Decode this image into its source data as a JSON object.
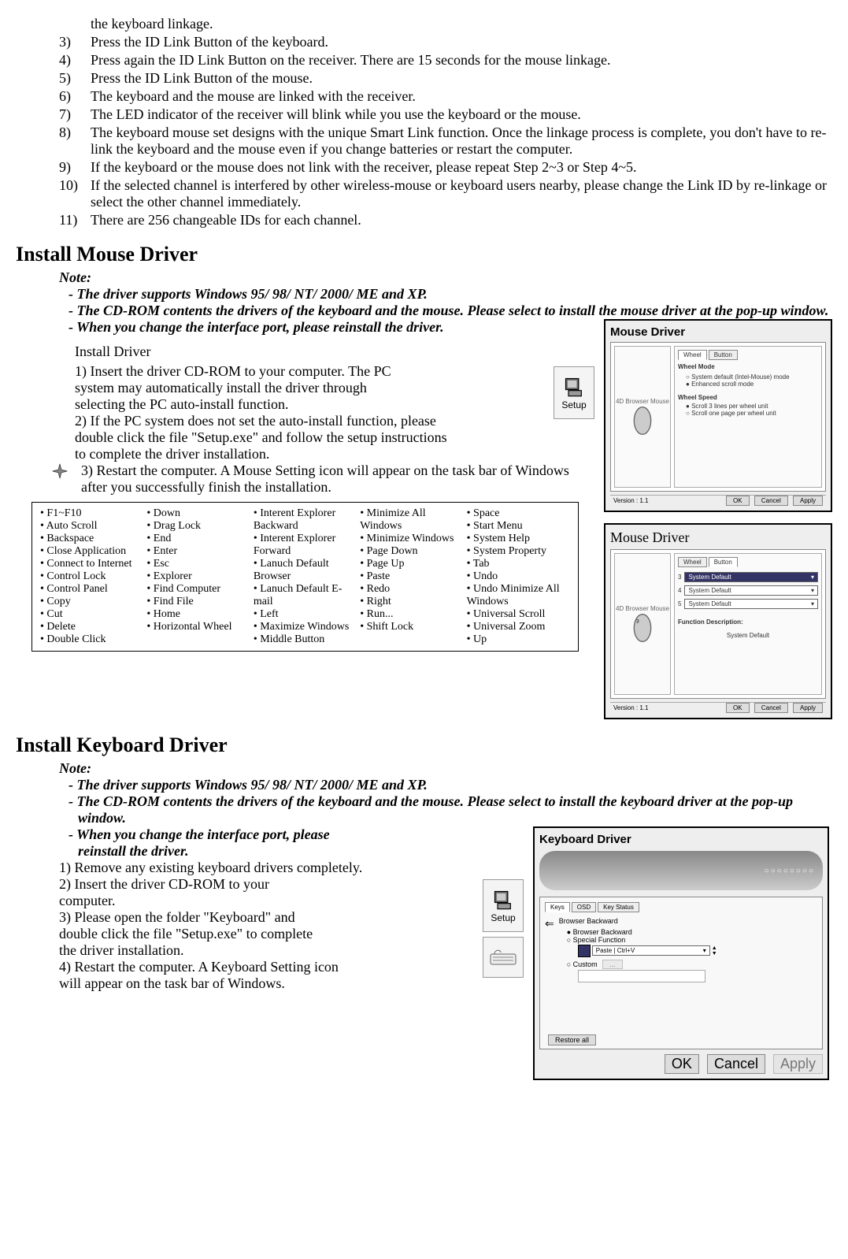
{
  "top_steps": [
    {
      "n": "",
      "t": "the keyboard linkage."
    },
    {
      "n": "3)",
      "t": "Press the ID Link Button of the keyboard."
    },
    {
      "n": "4)",
      "t": "Press again the ID Link Button on the receiver.  There are 15 seconds for the mouse linkage."
    },
    {
      "n": "5)",
      "t": "Press the ID Link Button of the mouse."
    },
    {
      "n": "6)",
      "t": "The keyboard and the mouse are linked with the receiver."
    },
    {
      "n": "7)",
      "t": "The LED indicator of the receiver will blink while you use the keyboard or the mouse."
    },
    {
      "n": "8)",
      "t": "The keyboard mouse set designs with the unique Smart Link function.  Once the linkage process is complete, you don't have to re-link the keyboard and the mouse even if you change batteries or restart the computer."
    },
    {
      "n": "9)",
      "t": "If the keyboard or the mouse does not link with the receiver, please repeat Step 2~3 or Step 4~5."
    },
    {
      "n": "10)",
      "t": "If the selected channel is interfered by other wireless-mouse or keyboard users nearby, please change the Link ID by re-linkage or select the other channel immediately."
    },
    {
      "n": "11)",
      "t": "There are 256 changeable IDs for each channel."
    }
  ],
  "mouse": {
    "heading": "Install Mouse Driver",
    "note_label": "Note:",
    "notes": [
      "- The driver supports Windows 95/ 98/ NT/ 2000/ ME and XP.",
      "- The CD-ROM contents the drivers of the keyboard and the mouse.  Please select to install the mouse driver at the pop-up window.",
      "- When you change the interface port, please reinstall the driver."
    ],
    "install_title": "Install Driver",
    "install_steps": [
      "1) Insert the driver CD-ROM to your computer.  The PC system may automatically install the driver through selecting the PC auto-install function.",
      "2) If the PC system does not set the auto-install function, please double click the file \"Setup.exe\" and follow the setup instructions to complete the driver installation.",
      "3) Restart the computer.  A Mouse Setting icon will appear on the task bar of Windows after you successfully finish the installation."
    ],
    "setup_label": "Setup",
    "shot1": {
      "title": "Mouse Driver",
      "left_label": "4D Browser Mouse",
      "version": "Version : 1.1",
      "tab1": "Wheel",
      "tab2": "Button",
      "heading": "Wheel Mode",
      "opt1": "System default (Intel-Mouse) mode",
      "opt2": "Enhanced scroll mode",
      "heading2": "Wheel Speed",
      "opt3": "Scroll   3   lines per wheel unit",
      "opt4": "Scroll one page per wheel unit",
      "btn_ok": "OK",
      "btn_cancel": "Cancel",
      "btn_apply": "Apply"
    },
    "shot2": {
      "title": "Mouse Driver",
      "left_label": "4D Browser Mouse",
      "version": "Version : 1.1",
      "tab1": "Wheel",
      "tab2": "Button",
      "row3": "3",
      "row4": "4",
      "row5": "5",
      "dd_label": "System Default",
      "dd_top": "System Default",
      "func_head": "Function Description:",
      "func_text": "System Default",
      "btn_ok": "OK",
      "btn_cancel": "Cancel",
      "btn_apply": "Apply"
    }
  },
  "func_cols": [
    [
      "• F1~F10",
      "• Auto Scroll",
      "• Backspace",
      "• Close Application",
      "• Connect to Internet",
      "• Control Lock",
      "• Control Panel",
      "• Copy",
      "• Cut",
      "• Delete",
      "• Double Click"
    ],
    [
      "• Down",
      "• Drag Lock",
      "• End",
      "• Enter",
      "• Esc",
      "• Explorer",
      "• Find Computer",
      "• Find File",
      "• Home",
      "• Horizontal Wheel"
    ],
    [
      "• Interent Explorer Backward",
      "• Interent Explorer Forward",
      "• Lanuch Default Browser",
      "• Lanuch Default E-mail",
      "• Left",
      "• Maximize Windows",
      "• Middle Button"
    ],
    [
      "• Minimize All Windows",
      "• Minimize Windows",
      "• Page Down",
      "• Page Up",
      "• Paste",
      "• Redo",
      "• Right",
      "• Run...",
      "• Shift Lock"
    ],
    [
      "• Space",
      "• Start Menu",
      "• System Help",
      "• System Property",
      "• Tab",
      "• Undo",
      "• Undo Minimize All Windows",
      "• Universal Scroll",
      "• Universal Zoom",
      "• Up"
    ]
  ],
  "keyboard": {
    "heading": "Install Keyboard Driver",
    "note_label": "Note:",
    "notes": [
      "- The driver supports Windows 95/ 98/ NT/ 2000/ ME and XP.",
      "- The CD-ROM contents the drivers of the keyboard and the mouse.  Please select to install the keyboard driver at the pop-up window.",
      "- When you change the interface port, please reinstall the driver."
    ],
    "steps": [
      "1) Remove any existing keyboard drivers completely.",
      "2) Insert the driver CD-ROM to your computer.",
      "3) Please open the folder \"Keyboard\" and double click the file \"Setup.exe\" to complete the driver installation.",
      "4) Restart the computer.  A Keyboard Setting icon will appear on the task bar of Windows."
    ],
    "setup_label": "Setup",
    "shot": {
      "title": "Keyboard Driver",
      "tab1": "Keys",
      "tab2": "OSD",
      "tab3": "Key Status",
      "label": "Browser Backward",
      "r1": "Browser Backward",
      "r2": "Special Function",
      "dd": "Paste | Ctrl+V",
      "r3": "Custom",
      "restore": "Restore all",
      "btn_ok": "OK",
      "btn_cancel": "Cancel",
      "btn_apply": "Apply"
    }
  }
}
